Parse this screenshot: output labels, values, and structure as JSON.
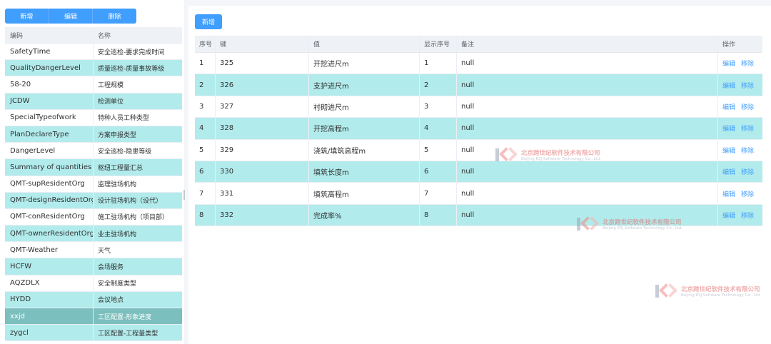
{
  "left_panel": {
    "toolbar": {
      "add": "新增",
      "edit": "编辑",
      "delete": "删除"
    },
    "headers": {
      "code": "编码",
      "name": "名称"
    },
    "rows": [
      {
        "code": "SafetyTime",
        "name": "安全巡检-要求完成时间"
      },
      {
        "code": "QualityDangerLevel",
        "name": "质量巡检-质量事故等级"
      },
      {
        "code": "58-20",
        "name": "工程规模"
      },
      {
        "code": "JCDW",
        "name": "检测单位"
      },
      {
        "code": "SpecialTypeofwork",
        "name": "特种人员工种类型"
      },
      {
        "code": "PlanDeclareType",
        "name": "方案申报类型"
      },
      {
        "code": "DangerLevel",
        "name": "安全巡检-隐患等级"
      },
      {
        "code": "Summary of quantities",
        "name": "枢纽工程量汇总"
      },
      {
        "code": "QMT-supResidentOrg",
        "name": "监理驻场机构"
      },
      {
        "code": "QMT-designResidentOrg",
        "name": "设计驻场机构（设代）"
      },
      {
        "code": "QMT-conResidentOrg",
        "name": "施工驻场机构（项目部）"
      },
      {
        "code": "QMT-ownerResidentOrg",
        "name": "业主驻场机构"
      },
      {
        "code": "QMT-Weather",
        "name": "天气"
      },
      {
        "code": "HCFW",
        "name": "会场服务"
      },
      {
        "code": "AQZDLX",
        "name": "安全制度类型"
      },
      {
        "code": "HYDD",
        "name": "会议地点"
      },
      {
        "code": "xxjd",
        "name": "工区配置-形象进度"
      },
      {
        "code": "zygcl",
        "name": "工区配置-工程量类型"
      }
    ],
    "selected_index": 16
  },
  "right_panel": {
    "add_label": "新增",
    "headers": {
      "index": "序号",
      "key": "键",
      "value": "值",
      "order": "显示序号",
      "note": "备注",
      "ops": "操作"
    },
    "edit_label": "编辑",
    "remove_label": "移除",
    "rows": [
      {
        "index": "1",
        "key": "325",
        "value": "开挖进尺m",
        "order": "1",
        "note": "null"
      },
      {
        "index": "2",
        "key": "326",
        "value": "支护进尺m",
        "order": "2",
        "note": "null"
      },
      {
        "index": "3",
        "key": "327",
        "value": "衬砌进尺m",
        "order": "3",
        "note": "null"
      },
      {
        "index": "4",
        "key": "328",
        "value": "开挖高程m",
        "order": "4",
        "note": "null"
      },
      {
        "index": "5",
        "key": "329",
        "value": "浇筑/填筑高程m",
        "order": "5",
        "note": "null"
      },
      {
        "index": "6",
        "key": "330",
        "value": "填筑长度m",
        "order": "6",
        "note": "null"
      },
      {
        "index": "7",
        "key": "331",
        "value": "填筑高程m",
        "order": "7",
        "note": "null"
      },
      {
        "index": "8",
        "key": "332",
        "value": "完成率%",
        "order": "8",
        "note": "null"
      }
    ]
  },
  "watermark": {
    "cn": "北京跨世纪软件技术有限公司",
    "en": "Beijing KSJ Software Technology Co., Ltd.",
    "logo_text": "LKSJ"
  },
  "colors": {
    "primary": "#409eff",
    "row_alt": "#b2ebeb",
    "row_selected": "#7bbfbe",
    "header_bg": "#eef1f6"
  }
}
